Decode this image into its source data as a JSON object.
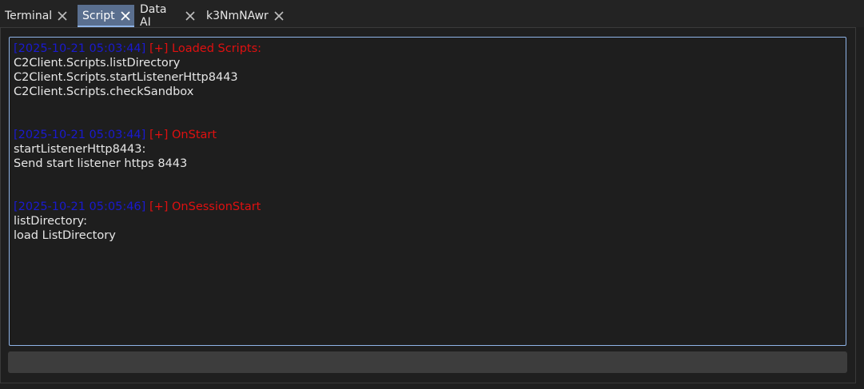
{
  "tabs": [
    {
      "label": "Terminal",
      "active": false
    },
    {
      "label": "Script",
      "active": true
    },
    {
      "label": "Data AI",
      "active": false
    },
    {
      "label": "k3NmNAwr",
      "active": false
    }
  ],
  "console": {
    "blocks": [
      {
        "timestamp": "[2025-10-21 05:03:44]",
        "tag": "[+] Loaded Scripts:",
        "lines": [
          "C2Client.Scripts.listDirectory",
          "C2Client.Scripts.startListenerHttp8443",
          "C2Client.Scripts.checkSandbox"
        ]
      },
      {
        "timestamp": "[2025-10-21 05:03:44]",
        "tag": "[+] OnStart",
        "lines": [
          "startListenerHttp8443:",
          "Send start listener https 8443"
        ]
      },
      {
        "timestamp": "[2025-10-21 05:05:46]",
        "tag": "[+] OnSessionStart",
        "lines": [
          "listDirectory:",
          "load ListDirectory"
        ]
      }
    ]
  },
  "icons": {
    "tab_close": "close-icon"
  },
  "colors": {
    "timestamp": "#1a1acf",
    "tag": "#e01010",
    "text": "#e6e6e6",
    "active_tab": "#5a6f8f",
    "console_border": "#8fb4e8"
  },
  "command_input": {
    "value": ""
  }
}
